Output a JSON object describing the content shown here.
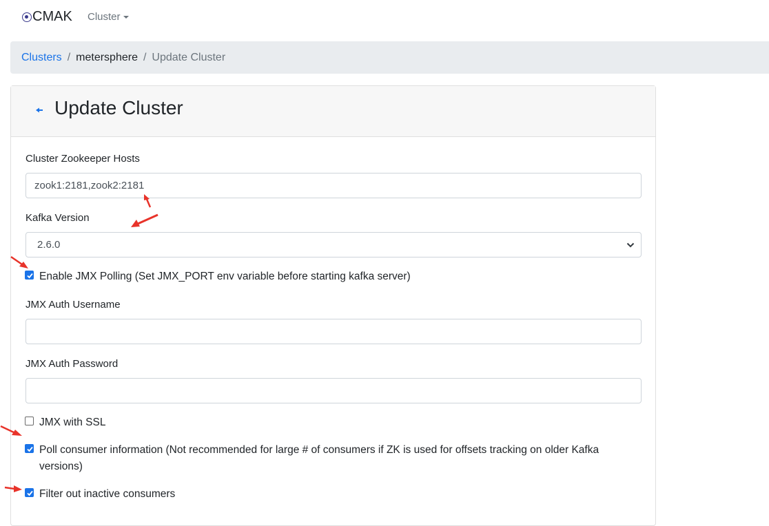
{
  "navbar": {
    "brand": "CMAK",
    "brand_icon": "target-icon",
    "cluster_menu": "Cluster"
  },
  "breadcrumb": {
    "items": [
      "Clusters",
      "metersphere",
      "Update Cluster"
    ]
  },
  "card": {
    "title": "Update Cluster",
    "back_icon": "back-arrow-icon"
  },
  "form": {
    "zk_hosts_label": "Cluster Zookeeper Hosts",
    "zk_hosts_value": "zook1:2181,zook2:2181",
    "kafka_version_label": "Kafka Version",
    "kafka_version_value": "2.6.0",
    "enable_jmx_label": "Enable JMX Polling (Set JMX_PORT env variable before starting kafka server)",
    "enable_jmx_checked": true,
    "jmx_user_label": "JMX Auth Username",
    "jmx_user_value": "",
    "jmx_pass_label": "JMX Auth Password",
    "jmx_pass_value": "",
    "jmx_ssl_label": "JMX with SSL",
    "jmx_ssl_checked": false,
    "poll_consumer_label_line1": "Poll consumer information (Not recommended for large # of consumers if ZK is used for offsets tracking on older Kafka",
    "poll_consumer_label_line2": "versions)",
    "poll_consumer_checked": true,
    "filter_inactive_label": "Filter out inactive consumers",
    "filter_inactive_checked": true
  },
  "colors": {
    "accent": "#1a73e8",
    "annotation_arrow": "#e8332a",
    "breadcrumb_bg": "#e9ecef",
    "card_header_bg": "#f7f7f7"
  }
}
